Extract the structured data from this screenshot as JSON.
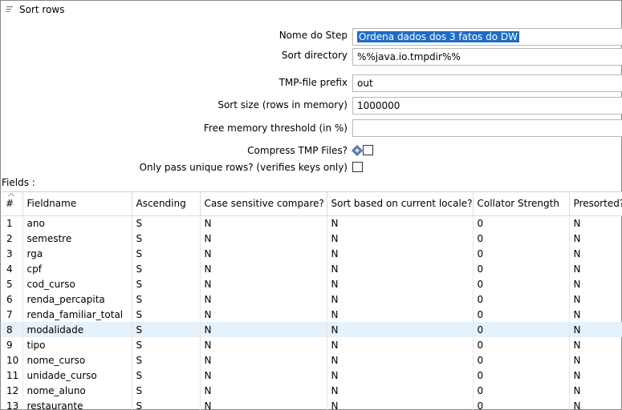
{
  "window": {
    "title": "Sort rows",
    "icon": "sort-list-icon"
  },
  "form": {
    "step_name": {
      "label": "Nome do Step",
      "value": "Ordena dados dos 3 fatos do DW"
    },
    "sort_directory": {
      "label": "Sort directory",
      "value": "%%java.io.tmpdir%%"
    },
    "tmp_prefix": {
      "label": "TMP-file prefix",
      "value": "out"
    },
    "sort_size": {
      "label": "Sort size (rows in memory)",
      "value": "1000000"
    },
    "free_memory": {
      "label": "Free memory threshold (in %)",
      "value": ""
    },
    "compress": {
      "label": "Compress TMP Files?",
      "checked": false,
      "icon": "variable-diamond-icon"
    },
    "unique_rows": {
      "label": "Only pass unique rows? (verifies keys only)",
      "checked": false
    }
  },
  "fields_label": "Fields :",
  "table": {
    "columns": [
      "#",
      "Fieldname",
      "Ascending",
      "Case sensitive compare?",
      "Sort based on current locale?",
      "Collator Strength",
      "Presorted?"
    ],
    "selected_row": 8,
    "rows": [
      [
        "1",
        "ano",
        "S",
        "N",
        "N",
        "0",
        "N"
      ],
      [
        "2",
        "semestre",
        "S",
        "N",
        "N",
        "0",
        "N"
      ],
      [
        "3",
        "rga",
        "S",
        "N",
        "N",
        "0",
        "N"
      ],
      [
        "4",
        "cpf",
        "S",
        "N",
        "N",
        "0",
        "N"
      ],
      [
        "5",
        "cod_curso",
        "S",
        "N",
        "N",
        "0",
        "N"
      ],
      [
        "6",
        "renda_percapita",
        "S",
        "N",
        "N",
        "0",
        "N"
      ],
      [
        "7",
        "renda_familiar_total",
        "S",
        "N",
        "N",
        "0",
        "N"
      ],
      [
        "8",
        "modalidade",
        "S",
        "N",
        "N",
        "0",
        "N"
      ],
      [
        "9",
        "tipo",
        "S",
        "N",
        "N",
        "0",
        "N"
      ],
      [
        "10",
        "nome_curso",
        "S",
        "N",
        "N",
        "0",
        "N"
      ],
      [
        "11",
        "unidade_curso",
        "S",
        "N",
        "N",
        "0",
        "N"
      ],
      [
        "12",
        "nome_aluno",
        "S",
        "N",
        "N",
        "0",
        "N"
      ],
      [
        "13",
        "restaurante",
        "S",
        "N",
        "N",
        "0",
        "N"
      ]
    ]
  }
}
